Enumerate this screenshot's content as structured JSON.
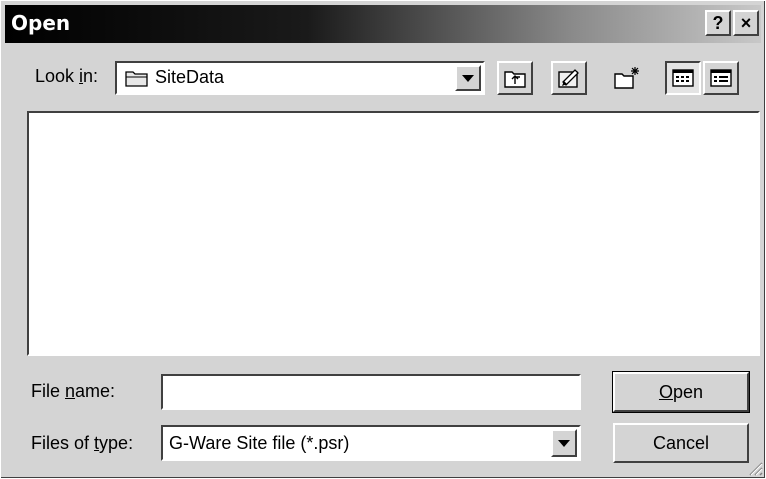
{
  "window": {
    "title": "Open"
  },
  "titlebar": {
    "help_label": "?",
    "close_label": "×"
  },
  "lookin": {
    "label_prefix": "Look ",
    "label_underline": "i",
    "label_suffix": "n:",
    "value": "SiteData"
  },
  "toolbar": {
    "buttons": [
      {
        "name": "up-one-level",
        "icon": "folder-up-icon"
      },
      {
        "name": "favorites",
        "icon": "favorites-icon"
      },
      {
        "name": "create-new-folder",
        "icon": "new-folder-icon"
      },
      {
        "name": "list-view",
        "icon": "list-view-icon"
      },
      {
        "name": "details-view",
        "icon": "details-view-icon"
      }
    ]
  },
  "filename": {
    "label_prefix": "File ",
    "label_underline": "n",
    "label_suffix": "ame:",
    "value": ""
  },
  "filetype": {
    "label_prefix": "Files of ",
    "label_underline": "t",
    "label_suffix": "ype:",
    "value": "G-Ware Site file (*.psr)"
  },
  "buttons": {
    "open_underline": "O",
    "open_rest": "pen",
    "cancel": "Cancel"
  }
}
